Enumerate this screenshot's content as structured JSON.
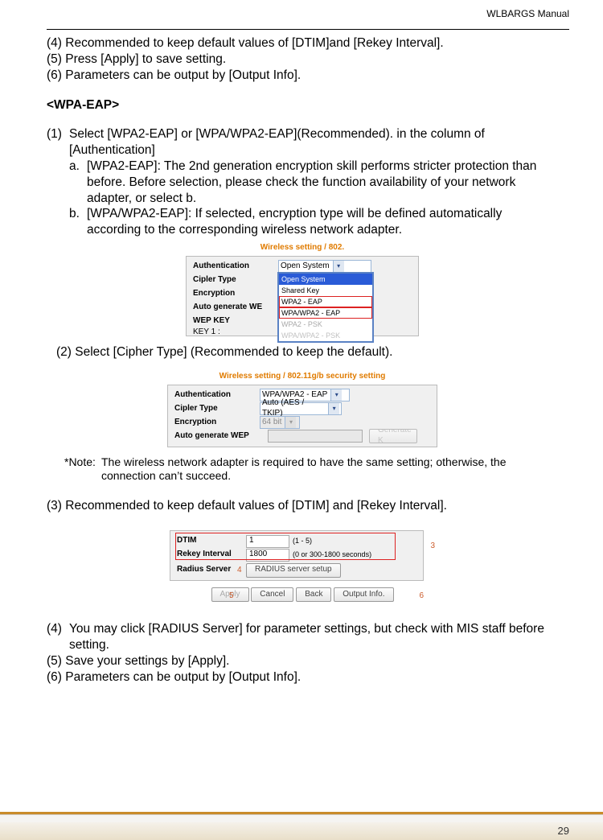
{
  "header": {
    "manual_name": "WLBARGS Manual"
  },
  "top": {
    "p4": "(4) Recommended to keep default values of [DTIM]and [Rekey Interval].",
    "p5": "(5) Press [Apply] to save setting.",
    "p6": "(6) Parameters can be output by [Output Info]."
  },
  "section": {
    "title": "<WPA-EAP>"
  },
  "s1": {
    "num": "(1)",
    "text": "Select [WPA2-EAP] or [WPA/WPA2-EAP](Recommended). in the column of [Authentication]",
    "a_letter": "a.",
    "a_text": "[WPA2-EAP]: The 2nd generation encryption skill performs stricter protec­tion than before.  Before selection, please check the function availability of your network adapter, or select b.",
    "b_letter": "b.",
    "b_text": "[WPA/WPA2-EAP]: If selected, encryption type will be defined automati­cally according to the corresponding wireless network adapter."
  },
  "shot1": {
    "title": "Wireless setting / 802.",
    "auth_label": "Authentication",
    "cipher_label": "Cipler Type",
    "enc_label": "Encryption",
    "autowep_label": "Auto generate WE",
    "wepkey_label": "WEP KEY",
    "key1_label": "KEY 1 :",
    "sel_value": "Open System",
    "opts": {
      "o1": "Open System",
      "o2": "Shared Key",
      "o3": "WPA2 - EAP",
      "o4": "WPA/WPA2 - EAP",
      "o5": "WPA2 - PSK",
      "o6": "WPA/WPA2 - PSK"
    }
  },
  "s2": {
    "text": "(2) Select [Cipher Type] (Recommended to keep the default)."
  },
  "shot2": {
    "title": "Wireless setting / 802.11g/b security setting",
    "auth_label": "Authentication",
    "cipher_label": "Cipler Type",
    "enc_label": "Encryption",
    "autowep_label": "Auto generate WEP",
    "auth_value": "WPA/WPA2 - EAP",
    "cipher_value": "Auto (AES / TKIP)",
    "enc_value": "64 bit",
    "gen_btn": "Generate K"
  },
  "note": {
    "label": "*Note:",
    "text": "The wireless network adapter is required to have the same setting; otherwise, the connection can’t succeed."
  },
  "s3": {
    "text": "(3) Recommended to keep default values of [DTIM] and [Rekey Interval]."
  },
  "shot3": {
    "dtim_label": "DTIM",
    "rekey_label": "Rekey Interval",
    "radius_label": "Radius Server",
    "dtim_value": "1",
    "dtim_hint": "(1 - 5)",
    "rekey_value": "1800",
    "rekey_hint": "(0 or 300-1800 seconds)",
    "radius_btn": "RADIUS server setup",
    "apply": "Apply",
    "cancel": "Cancel",
    "back": "Back",
    "output": "Output Info.",
    "ann3": "3",
    "ann4": "4",
    "ann5": "5",
    "ann6": "6"
  },
  "bottom": {
    "p4a": "(4)",
    "p4b": "You may click [RADIUS Server] for parameter settings, but check with MIS staff before setting.",
    "p5": "(5) Save your settings by [Apply].",
    "p6": "(6) Parameters can be output by [Output Info]."
  },
  "footer": {
    "page_no": "29"
  }
}
